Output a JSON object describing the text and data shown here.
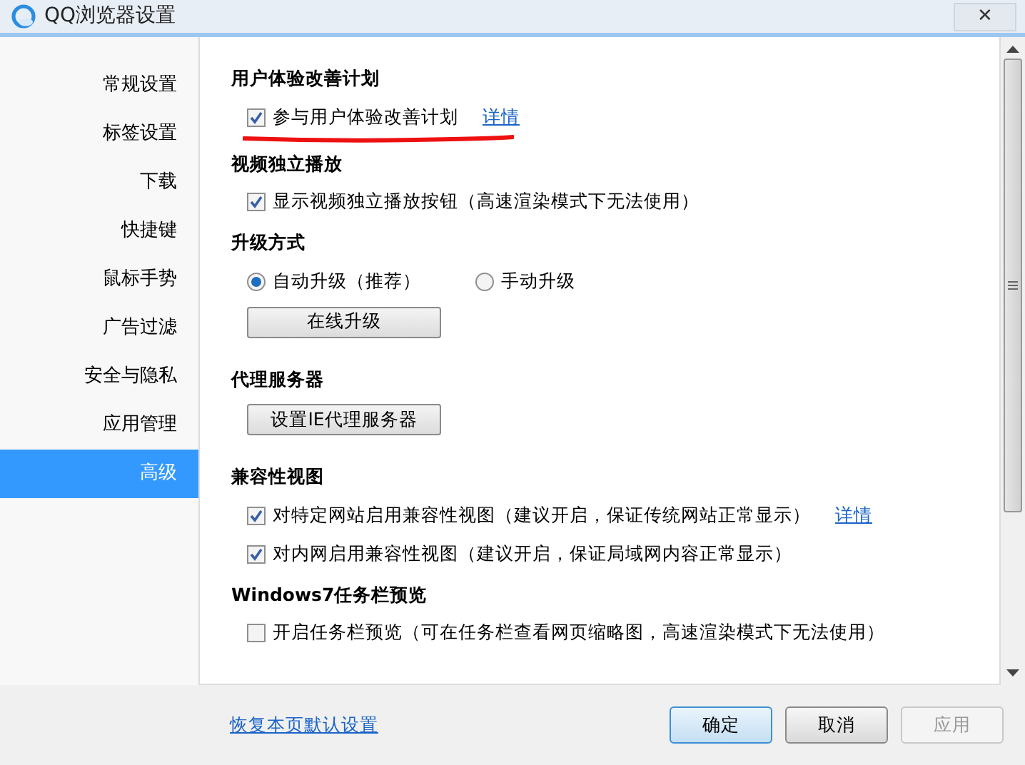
{
  "window": {
    "title": "QQ浏览器设置",
    "close": "✕"
  },
  "sidebar": {
    "items": [
      {
        "label": "常规设置",
        "selected": false
      },
      {
        "label": "标签设置",
        "selected": false
      },
      {
        "label": "下载",
        "selected": false
      },
      {
        "label": "快捷键",
        "selected": false
      },
      {
        "label": "鼠标手势",
        "selected": false
      },
      {
        "label": "广告过滤",
        "selected": false
      },
      {
        "label": "安全与隐私",
        "selected": false
      },
      {
        "label": "应用管理",
        "selected": false
      },
      {
        "label": "高级",
        "selected": true
      }
    ]
  },
  "sections": [
    {
      "title": "用户体验改善计划",
      "items": [
        {
          "kind": "checkbox",
          "label": "参与用户体验改善计划",
          "checked": true,
          "link": "详情",
          "underlined": true
        }
      ]
    },
    {
      "title": "视频独立播放",
      "items": [
        {
          "kind": "checkbox",
          "label": "显示视频独立播放按钮（高速渲染模式下无法使用）",
          "checked": true
        }
      ]
    },
    {
      "title": "升级方式",
      "items": [
        {
          "kind": "radio",
          "options": [
            {
              "label": "自动升级（推荐）",
              "selected": true
            },
            {
              "label": "手动升级",
              "selected": false
            }
          ]
        },
        {
          "kind": "button",
          "label": "在线升级"
        }
      ]
    },
    {
      "title": "代理服务器",
      "items": [
        {
          "kind": "button",
          "label": "设置IE代理服务器"
        }
      ]
    },
    {
      "title": "兼容性视图",
      "items": [
        {
          "kind": "checkbox",
          "label": "对特定网站启用兼容性视图（建议开启，保证传统网站正常显示）",
          "checked": true,
          "link": "详情"
        },
        {
          "kind": "checkbox",
          "label": "对内网启用兼容性视图（建议开启，保证局域网内容正常显示）",
          "checked": true
        }
      ]
    },
    {
      "title": "Windows7任务栏预览",
      "items": [
        {
          "kind": "checkbox",
          "label": "开启任务栏预览（可在任务栏查看网页缩略图，高速渲染模式下无法使用）",
          "checked": false
        }
      ]
    }
  ],
  "footer": {
    "link": "恢复本页默认设置",
    "buttons": [
      {
        "label": "确定",
        "kind": "default",
        "disabled": false
      },
      {
        "label": "取消",
        "kind": "normal",
        "disabled": false
      },
      {
        "label": "应用",
        "kind": "normal",
        "disabled": true
      }
    ]
  }
}
